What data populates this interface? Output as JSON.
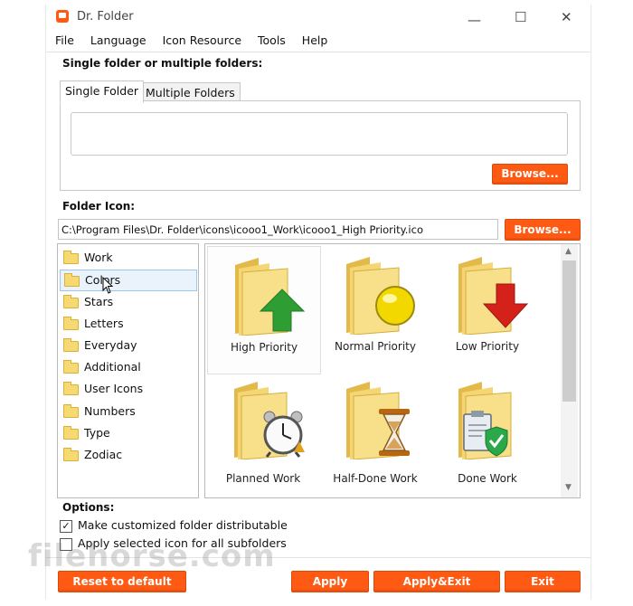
{
  "window": {
    "title": "Dr. Folder"
  },
  "menu": [
    "File",
    "Language",
    "Icon Resource",
    "Tools",
    "Help"
  ],
  "single_section": {
    "heading": "Single folder or multiple folders:",
    "tabs": [
      "Single Folder",
      "Multiple Folders"
    ],
    "browse_label": "Browse..."
  },
  "folder_icon": {
    "heading": "Folder Icon:",
    "path": "C:\\Program Files\\Dr. Folder\\icons\\icooo1_Work\\icooo1_High Priority.ico",
    "browse_label": "Browse..."
  },
  "categories": [
    "Work",
    "Colors",
    "Stars",
    "Letters",
    "Everyday",
    "Additional",
    "User Icons",
    "Numbers",
    "Type",
    "Zodiac"
  ],
  "icons": [
    {
      "label": "High Priority",
      "badge": "up-arrow-icon",
      "color": "#2e9e34"
    },
    {
      "label": "Normal Priority",
      "badge": "circle-icon",
      "color": "#f3d800"
    },
    {
      "label": "Low Priority",
      "badge": "down-arrow-icon",
      "color": "#d4221b"
    },
    {
      "label": "Planned Work",
      "badge": "alarm-clock-icon",
      "color": "#cfcfcf"
    },
    {
      "label": "Half-Done Work",
      "badge": "hourglass-icon",
      "color": "#b8660f"
    },
    {
      "label": "Done Work",
      "badge": "clipboard-check-icon",
      "color": "#2aa84a"
    }
  ],
  "options": {
    "heading": "Options:",
    "items": [
      {
        "label": "Make customized folder distributable",
        "checked": true
      },
      {
        "label": "Apply selected icon for all subfolders",
        "checked": false
      }
    ]
  },
  "buttons": {
    "reset": "Reset to default",
    "apply": "Apply",
    "apply_exit": "Apply&Exit",
    "exit": "Exit"
  },
  "watermark": "filehorse.com",
  "colors": {
    "accent": "#ff5a13",
    "folder": "#f6d971"
  }
}
